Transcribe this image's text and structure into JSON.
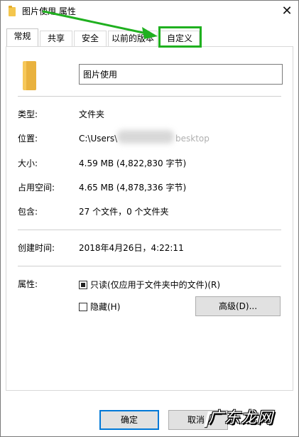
{
  "window": {
    "title": "图片使用 属性",
    "close_glyph": "✕"
  },
  "tabs": [
    "常规",
    "共享",
    "安全",
    "以前的版本",
    "自定义"
  ],
  "general": {
    "name_value": "图片使用",
    "rows": [
      {
        "label": "类型:",
        "value": "文件夹"
      },
      {
        "label": "位置:",
        "value": "C:\\Users\\",
        "value_tail": "besktop"
      },
      {
        "label": "大小:",
        "value": "4.59 MB (4,822,830 字节)"
      },
      {
        "label": "占用空间:",
        "value": "4.65 MB (4,878,336 字节)"
      },
      {
        "label": "包含:",
        "value": "27 个文件，0 个文件夹"
      },
      {
        "label": "创建时间:",
        "value": "2018年4月26日，4:22:11"
      }
    ],
    "attributes": {
      "label": "属性:",
      "readonly_label": "只读(仅应用于文件夹中的文件)(R)",
      "readonly_state": "indeterminate",
      "hidden_label": "隐藏(H)",
      "hidden_checked": false,
      "advanced_label": "高级(D)..."
    }
  },
  "footer": {
    "ok_label": "确定",
    "cancel_label": "取消"
  },
  "annotation": {
    "watermark_text": "广东龙网",
    "highlight_color": "#1fb01f",
    "arrow_color": "#1fb01f"
  },
  "icons": {
    "title_icon": "folder-icon",
    "large_icon": "folder-icon",
    "close_icon": "close-icon",
    "arrow": "arrow-annotation"
  }
}
